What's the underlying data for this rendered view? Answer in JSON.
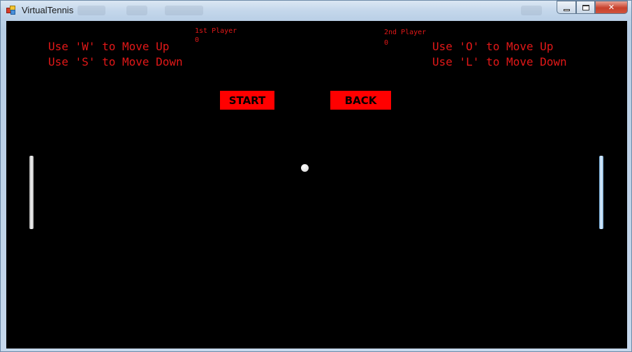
{
  "window": {
    "title": "VirtualTennis",
    "close_glyph": "✕"
  },
  "game": {
    "player1": {
      "label": "1st Player",
      "score": "0"
    },
    "player2": {
      "label": "2nd Player",
      "score": "0"
    },
    "instructions_left": {
      "line1": "Use 'W' to Move Up",
      "line2": "Use 'S' to Move Down"
    },
    "instructions_right": {
      "line1": "Use 'O' to Move Up",
      "line2": "Use 'L' to Move Down"
    },
    "buttons": {
      "start": "START",
      "back": "BACK"
    }
  },
  "colors": {
    "background": "#000000",
    "text": "#e21818",
    "button": "#ff0000"
  }
}
